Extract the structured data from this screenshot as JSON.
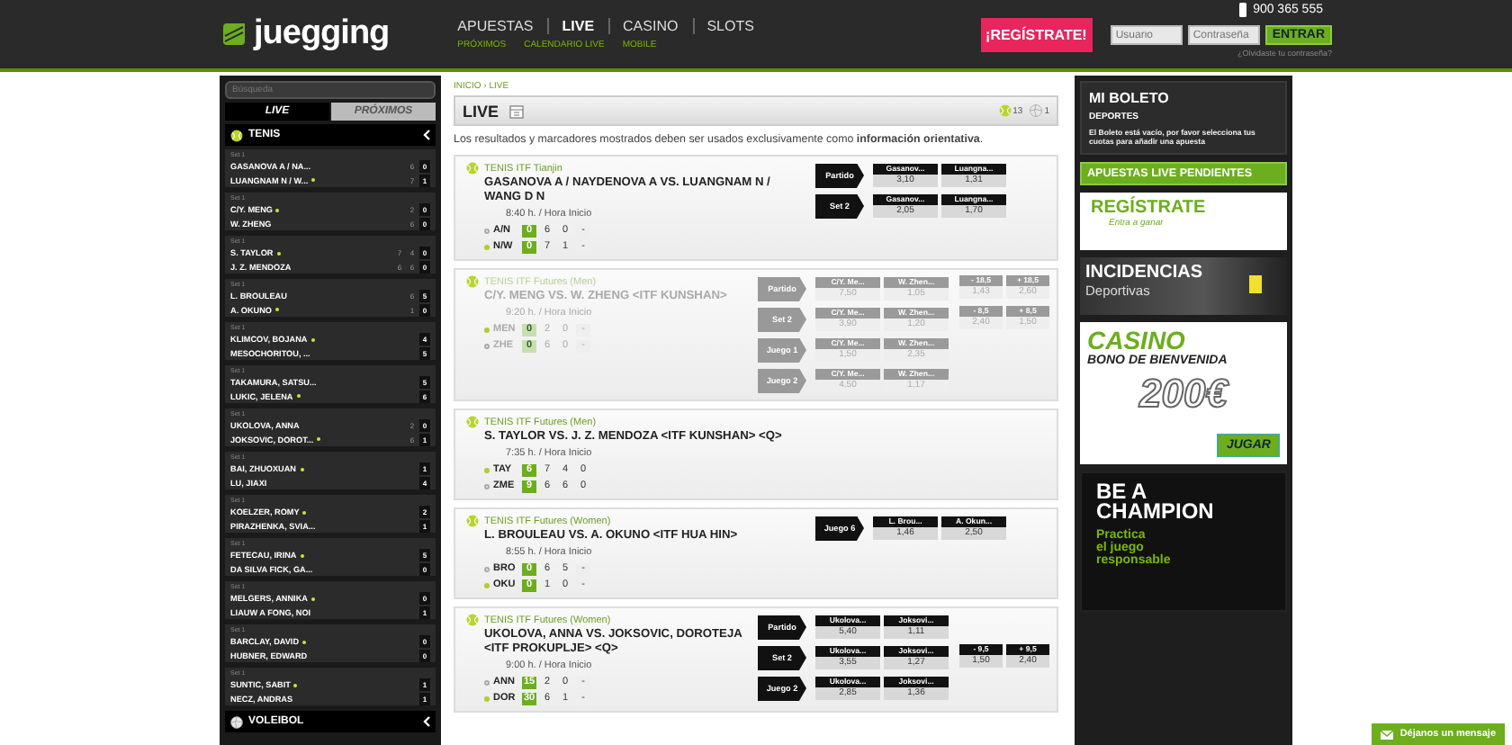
{
  "header": {
    "logo": "juegging",
    "nav": [
      {
        "label": "APUESTAS",
        "selected": false
      },
      {
        "label": "LIVE",
        "selected": true
      },
      {
        "label": "CASINO",
        "selected": false
      },
      {
        "label": "SLOTS",
        "selected": false
      }
    ],
    "subnav": [
      "PRÓXIMOS",
      "CALENDARIO LIVE",
      "MOBILE"
    ],
    "register": "¡REGÍSTRATE!",
    "phone": "900 365 555",
    "login": {
      "user_placeholder": "Usuario",
      "password_placeholder": "Contraseña",
      "submit": "ENTRAR",
      "forgot": "¿Olvidaste tu contraseña?"
    }
  },
  "sidebar": {
    "search_placeholder": "Búsqueda",
    "tabs": [
      {
        "label": "LIVE",
        "selected": true
      },
      {
        "label": "PRÓXIMOS",
        "selected": false
      }
    ],
    "sports": [
      {
        "kind": "tennis",
        "name": "TENIS",
        "matches": [
          {
            "period": "Set 1",
            "players": [
              {
                "name": "GASANOVA A / NA...",
                "serving": false,
                "scores": [
                  "6",
                  "0"
                ]
              },
              {
                "name": "LUANGNAM N / W...",
                "serving": true,
                "scores": [
                  "7",
                  "1"
                ]
              }
            ]
          },
          {
            "period": "Set 1",
            "players": [
              {
                "name": "C/Y. MENG",
                "serving": true,
                "scores": [
                  "2",
                  "0"
                ]
              },
              {
                "name": "W. ZHENG",
                "serving": false,
                "scores": [
                  "6",
                  "0"
                ]
              }
            ]
          },
          {
            "period": "Set 1",
            "players": [
              {
                "name": "S. TAYLOR",
                "serving": true,
                "scores": [
                  "7",
                  "4",
                  "0"
                ]
              },
              {
                "name": "J. Z. MENDOZA",
                "serving": false,
                "scores": [
                  "6",
                  "6",
                  "0"
                ]
              }
            ]
          },
          {
            "period": "Set 1",
            "players": [
              {
                "name": "L. BROULEAU",
                "serving": false,
                "scores": [
                  "6",
                  "5"
                ]
              },
              {
                "name": "A. OKUNO",
                "serving": true,
                "scores": [
                  "1",
                  "0"
                ]
              }
            ]
          },
          {
            "period": "Set 1",
            "players": [
              {
                "name": "KLIMCOV, BOJANA",
                "serving": true,
                "scores": [
                  "4"
                ]
              },
              {
                "name": "MESOCHORITOU, ...",
                "serving": false,
                "scores": [
                  "5"
                ]
              }
            ]
          },
          {
            "period": "Set 1",
            "players": [
              {
                "name": "TAKAMURA, SATSU...",
                "serving": false,
                "scores": [
                  "5"
                ]
              },
              {
                "name": "LUKIC, JELENA",
                "serving": true,
                "scores": [
                  "6"
                ]
              }
            ]
          },
          {
            "period": "Set 1",
            "players": [
              {
                "name": "UKOLOVA, ANNA",
                "serving": false,
                "scores": [
                  "2",
                  "0"
                ]
              },
              {
                "name": "JOKSOVIC, DOROT...",
                "serving": true,
                "scores": [
                  "6",
                  "1"
                ]
              }
            ]
          },
          {
            "period": "Set 1",
            "players": [
              {
                "name": "BAI, ZHUOXUAN",
                "serving": true,
                "scores": [
                  "1"
                ]
              },
              {
                "name": "LU, JIAXI",
                "serving": false,
                "scores": [
                  "4"
                ]
              }
            ]
          },
          {
            "period": "Set 1",
            "players": [
              {
                "name": "KOELZER, ROMY",
                "serving": true,
                "scores": [
                  "2"
                ]
              },
              {
                "name": "PIRAZHENKA, SVIA...",
                "serving": false,
                "scores": [
                  "1"
                ]
              }
            ]
          },
          {
            "period": "Set 1",
            "players": [
              {
                "name": "FETECAU, IRINA",
                "serving": true,
                "scores": [
                  "5"
                ]
              },
              {
                "name": "DA SILVA FICK, GA...",
                "serving": false,
                "scores": [
                  "0"
                ]
              }
            ]
          },
          {
            "period": "Set 1",
            "players": [
              {
                "name": "MELGERS, ANNIKA",
                "serving": true,
                "scores": [
                  "0"
                ]
              },
              {
                "name": "LIAUW A FONG, NOI",
                "serving": false,
                "scores": [
                  "1"
                ]
              }
            ]
          },
          {
            "period": "Set 1",
            "players": [
              {
                "name": "BARCLAY, DAVID",
                "serving": true,
                "scores": [
                  "0"
                ]
              },
              {
                "name": "HUBNER, EDWARD",
                "serving": false,
                "scores": [
                  "0"
                ]
              }
            ]
          },
          {
            "period": "Set 1",
            "players": [
              {
                "name": "SUNTIC, SABIT",
                "serving": true,
                "scores": [
                  "1"
                ]
              },
              {
                "name": "NECZ, ANDRAS",
                "serving": false,
                "scores": [
                  "1"
                ]
              }
            ]
          }
        ]
      },
      {
        "kind": "volleyball",
        "name": "VOLEIBOL"
      }
    ]
  },
  "main": {
    "breadcrumb": {
      "items": [
        "INICIO",
        "LIVE"
      ],
      "separator": "›"
    },
    "title": "LIVE",
    "counts": [
      {
        "kind": "tennis",
        "text": "13"
      },
      {
        "kind": "volleyball",
        "text": "1"
      }
    ],
    "notice": "Los resultados y marcadores mostrados deben ser usados exclusivamente como **información orientativa**.",
    "events": [
      {
        "league": "TENIS ITF Tianjin",
        "title": "GASANOVA A / NAYDENOVA A VS. LUANGNAM N / WANG D N",
        "time": "8:40 h. / Hora Inicio",
        "disabled": false,
        "players": [
          {
            "code": "A/N",
            "serving": false,
            "scores": [
              "0",
              "6",
              "0",
              "-"
            ]
          },
          {
            "code": "N/W",
            "serving": true,
            "scores": [
              "0",
              "7",
              "1",
              "-"
            ]
          }
        ],
        "markets": [
          {
            "label": "Partido",
            "odds": [
              {
                "name": "Gasanov...",
                "value": "3,10"
              },
              {
                "name": "Luangna...",
                "value": "1,31"
              }
            ]
          },
          {
            "label": "Set 2",
            "odds": [
              {
                "name": "Gasanov...",
                "value": "2,05"
              },
              {
                "name": "Luangna...",
                "value": "1,70"
              }
            ]
          }
        ]
      },
      {
        "league": "TENIS ITF Futures (Men)",
        "title": "C/Y. MENG VS. W. ZHENG <ITF KUNSHAN>",
        "time": "9:20 h. / Hora Inicio",
        "disabled": true,
        "players": [
          {
            "code": "MEN",
            "serving": true,
            "scores": [
              "0",
              "2",
              "0",
              "-"
            ]
          },
          {
            "code": "ZHE",
            "serving": false,
            "scores": [
              "0",
              "6",
              "0",
              "-"
            ]
          }
        ],
        "markets": [
          {
            "label": "Partido",
            "odds": [
              {
                "name": "C/Y. Me...",
                "value": "7,50"
              },
              {
                "name": "W. Zhen...",
                "value": "1,05"
              }
            ],
            "extras": [
              {
                "name": "- 18,5",
                "value": "1,43"
              },
              {
                "name": "+ 18,5",
                "value": "2,60"
              }
            ]
          },
          {
            "label": "Set 2",
            "odds": [
              {
                "name": "C/Y. Me...",
                "value": "3,90"
              },
              {
                "name": "W. Zhen...",
                "value": "1,20"
              }
            ],
            "extras": [
              {
                "name": "- 8,5",
                "value": "2,40"
              },
              {
                "name": "+ 8,5",
                "value": "1,50"
              }
            ]
          },
          {
            "label": "Juego 1",
            "odds": [
              {
                "name": "C/Y. Me...",
                "value": "1,50"
              },
              {
                "name": "W. Zhen...",
                "value": "2,35"
              }
            ]
          },
          {
            "label": "Juego 2",
            "odds": [
              {
                "name": "C/Y. Me...",
                "value": "4,50"
              },
              {
                "name": "W. Zhen...",
                "value": "1,17"
              }
            ]
          }
        ]
      },
      {
        "league": "TENIS ITF Futures (Men)",
        "title": "S. TAYLOR VS. J. Z. MENDOZA <ITF KUNSHAN> <Q>",
        "time": "7:35 h. / Hora Inicio",
        "disabled": false,
        "players": [
          {
            "code": "TAY",
            "serving": true,
            "scores": [
              "6",
              "7",
              "4",
              "0"
            ]
          },
          {
            "code": "ZME",
            "serving": false,
            "scores": [
              "9",
              "6",
              "6",
              "0"
            ]
          }
        ]
      },
      {
        "league": "TENIS ITF Futures (Women)",
        "title": "L. BROULEAU VS. A. OKUNO <ITF HUA HIN>",
        "time": "8:55 h. / Hora Inicio",
        "disabled": false,
        "players": [
          {
            "code": "BRO",
            "serving": false,
            "scores": [
              "0",
              "6",
              "5",
              "-"
            ]
          },
          {
            "code": "OKU",
            "serving": true,
            "scores": [
              "0",
              "1",
              "0",
              "-"
            ]
          }
        ],
        "markets": [
          {
            "label": "Juego 6",
            "odds": [
              {
                "name": "L. Brou...",
                "value": "1,46"
              },
              {
                "name": "A. Okun...",
                "value": "2,50"
              }
            ]
          }
        ]
      },
      {
        "league": "TENIS ITF Futures (Women)",
        "title": "UKOLOVA, ANNA VS. JOKSOVIC, DOROTEJA <ITF PROKUPLJE> <Q>",
        "time": "9:00 h. / Hora Inicio",
        "disabled": false,
        "players": [
          {
            "code": "ANN",
            "serving": false,
            "scores": [
              "15",
              "2",
              "0",
              "-"
            ]
          },
          {
            "code": "DOR",
            "serving": true,
            "scores": [
              "30",
              "6",
              "1",
              "-"
            ]
          }
        ],
        "markets": [
          {
            "label": "Partido",
            "odds": [
              {
                "name": "Ukolova...",
                "value": "5,40"
              },
              {
                "name": "Joksovi...",
                "value": "1,11"
              }
            ]
          },
          {
            "label": "Set 2",
            "odds": [
              {
                "name": "Ukolova...",
                "value": "3,55"
              },
              {
                "name": "Joksovi...",
                "value": "1,27"
              }
            ],
            "extras": [
              {
                "name": "- 9,5",
                "value": "1,50"
              },
              {
                "name": "+ 9,5",
                "value": "2,40"
              }
            ]
          },
          {
            "label": "Juego 2",
            "odds": [
              {
                "name": "Ukolova...",
                "value": "2,85"
              },
              {
                "name": "Joksovi...",
                "value": "1,36"
              }
            ]
          }
        ]
      }
    ]
  },
  "betslip": {
    "title": "MI BOLETO",
    "section": "DEPORTES",
    "message": "El Boleto está vacío, por favor selecciona tus cuotas para añadir una apuesta",
    "pending": "APUESTAS LIVE PENDIENTES"
  },
  "banners": [
    {
      "kind": "register",
      "lines": [
        "REGÍSTRATE",
        "Entra a ganar"
      ]
    },
    {
      "kind": "incidents",
      "lines": [
        "INCIDENCIAS",
        "Deportivas"
      ]
    },
    {
      "kind": "casino",
      "lines": [
        "CASINO",
        "BONO DE BIENVENIDA",
        "200€",
        "JUGAR"
      ]
    },
    {
      "kind": "champion",
      "lines": [
        "BE A",
        "CHAMPION",
        "Practica",
        "el juego",
        "responsable"
      ]
    }
  ],
  "feedback": "Déjanos un mensaje"
}
